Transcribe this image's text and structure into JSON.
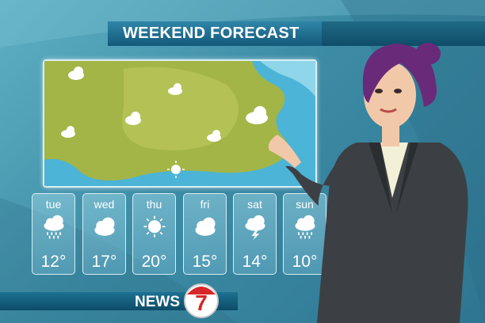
{
  "header": {
    "title": "WEEKEND FORECAST"
  },
  "colors": {
    "land": "#a3b546",
    "water": "#4cb4d6",
    "banner": "#14597a"
  },
  "forecast": [
    {
      "day": "tue",
      "icon": "rain-cloud-icon",
      "temp": "12°"
    },
    {
      "day": "wed",
      "icon": "cloud-icon",
      "temp": "17°"
    },
    {
      "day": "thu",
      "icon": "sun-icon",
      "temp": "20°"
    },
    {
      "day": "fri",
      "icon": "cloud-icon",
      "temp": "15°"
    },
    {
      "day": "sat",
      "icon": "storm-cloud-icon",
      "temp": "14°"
    },
    {
      "day": "sun",
      "icon": "rain-cloud-icon",
      "temp": "10°"
    }
  ],
  "footer": {
    "news_label": "NEWS",
    "channel_number": "7"
  }
}
